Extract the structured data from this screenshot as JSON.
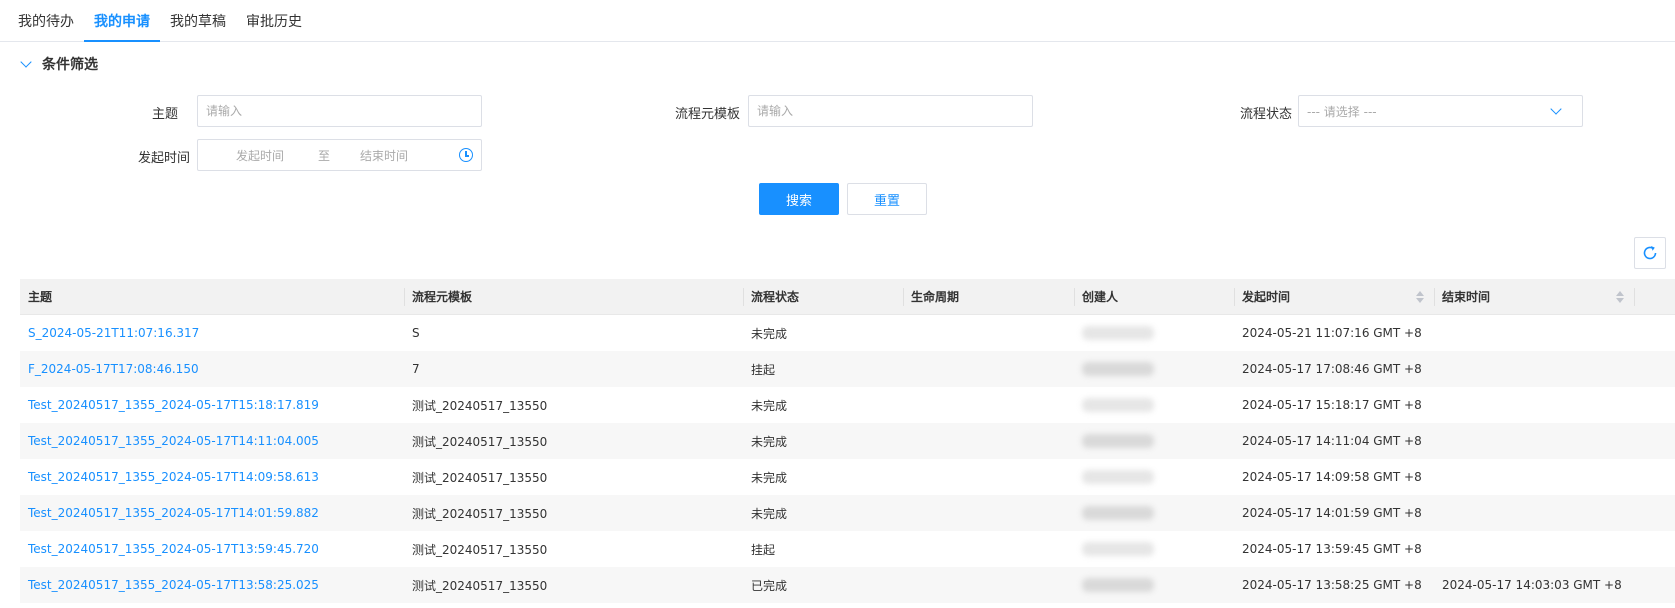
{
  "tabs": [
    {
      "label": "我的待办",
      "active": false
    },
    {
      "label": "我的申请",
      "active": true
    },
    {
      "label": "我的草稿",
      "active": false
    },
    {
      "label": "审批历史",
      "active": false
    }
  ],
  "filter": {
    "title": "条件筛选",
    "subject_label": "主题",
    "subject_placeholder": "请输入",
    "template_label": "流程元模板",
    "template_placeholder": "请输入",
    "status_label": "流程状态",
    "status_placeholder": "--- 请选择 ---",
    "time_label": "发起时间",
    "start_placeholder": "发起时间",
    "range_sep": "至",
    "end_placeholder": "结束时间",
    "search_button": "搜索",
    "reset_button": "重置"
  },
  "table": {
    "headers": [
      "主题",
      "流程元模板",
      "流程状态",
      "生命周期",
      "创建人",
      "发起时间",
      "结束时间"
    ],
    "rows": [
      {
        "subject": "S_2024-05-21T11:07:16.317",
        "template": "S",
        "status": "未完成",
        "lifecycle": "",
        "start": "2024-05-21 11:07:16 GMT +8",
        "end": ""
      },
      {
        "subject": "F_2024-05-17T17:08:46.150",
        "template": "7",
        "status": "挂起",
        "lifecycle": "",
        "start": "2024-05-17 17:08:46 GMT +8",
        "end": ""
      },
      {
        "subject": "Test_20240517_1355_2024-05-17T15:18:17.819",
        "template": "测试_20240517_13550",
        "status": "未完成",
        "lifecycle": "",
        "start": "2024-05-17 15:18:17 GMT +8",
        "end": ""
      },
      {
        "subject": "Test_20240517_1355_2024-05-17T14:11:04.005",
        "template": "测试_20240517_13550",
        "status": "未完成",
        "lifecycle": "",
        "start": "2024-05-17 14:11:04 GMT +8",
        "end": ""
      },
      {
        "subject": "Test_20240517_1355_2024-05-17T14:09:58.613",
        "template": "测试_20240517_13550",
        "status": "未完成",
        "lifecycle": "",
        "start": "2024-05-17 14:09:58 GMT +8",
        "end": ""
      },
      {
        "subject": "Test_20240517_1355_2024-05-17T14:01:59.882",
        "template": "测试_20240517_13550",
        "status": "未完成",
        "lifecycle": "",
        "start": "2024-05-17 14:01:59 GMT +8",
        "end": ""
      },
      {
        "subject": "Test_20240517_1355_2024-05-17T13:59:45.720",
        "template": "测试_20240517_13550",
        "status": "挂起",
        "lifecycle": "",
        "start": "2024-05-17 13:59:45 GMT +8",
        "end": ""
      },
      {
        "subject": "Test_20240517_1355_2024-05-17T13:58:25.025",
        "template": "测试_20240517_13550",
        "status": "已完成",
        "lifecycle": "",
        "start": "2024-05-17 13:58:25 GMT +8",
        "end": "2024-05-17 14:03:03 GMT +8"
      }
    ]
  },
  "colors": {
    "accent": "#1890ff",
    "header_bg": "#f2f2f2",
    "stripe": "#f7f7f7"
  }
}
